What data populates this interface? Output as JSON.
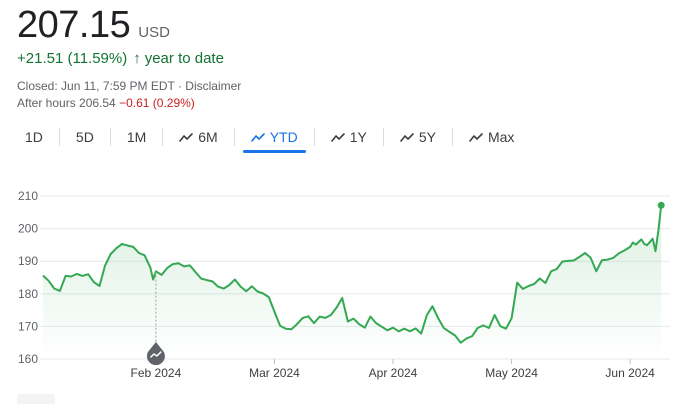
{
  "quote": {
    "price": "207.15",
    "currency": "USD",
    "change": "+21.51 (11.59%)",
    "arrow": "↑",
    "period": "year to date",
    "closed": "Closed: Jun 11, 7:59 PM EDT · Disclaimer",
    "after_hours_label": "After hours 206.54",
    "after_hours_change": "−0.61 (0.29%)"
  },
  "tabs": [
    {
      "label": "1D",
      "icon": false,
      "active": false
    },
    {
      "label": "5D",
      "icon": false,
      "active": false
    },
    {
      "label": "1M",
      "icon": false,
      "active": false
    },
    {
      "label": "6M",
      "icon": true,
      "active": false
    },
    {
      "label": "YTD",
      "icon": true,
      "active": true
    },
    {
      "label": "1Y",
      "icon": true,
      "active": false
    },
    {
      "label": "5Y",
      "icon": true,
      "active": false
    },
    {
      "label": "Max",
      "icon": true,
      "active": false
    }
  ],
  "colors": {
    "up": "#137333",
    "down": "#c5221f",
    "line": "#34a853",
    "accent": "#1a73e8"
  },
  "chart_data": {
    "type": "line",
    "ylim": [
      160,
      210
    ],
    "yticks": [
      160,
      170,
      180,
      190,
      200,
      210
    ],
    "xticks": [
      {
        "label": "Feb 2024",
        "x": 20
      },
      {
        "label": "Mar 2024",
        "x": 41
      },
      {
        "label": "Apr 2024",
        "x": 62
      },
      {
        "label": "May 2024",
        "x": 83
      },
      {
        "label": "Jun 2024",
        "x": 104
      }
    ],
    "x_range": [
      0,
      110
    ],
    "grid": true,
    "marker": {
      "x": 20,
      "y": 186.8,
      "icon": "trend-icon"
    },
    "end_point": {
      "x": 109.5,
      "y": 207.15
    },
    "series": [
      {
        "values": [
          [
            0,
            185.6
          ],
          [
            1,
            184
          ],
          [
            2,
            181.6
          ],
          [
            3,
            180.9
          ],
          [
            4,
            185.5
          ],
          [
            5,
            185.3
          ],
          [
            6,
            186.1
          ],
          [
            7,
            185.5
          ],
          [
            8,
            186
          ],
          [
            9,
            183.6
          ],
          [
            10,
            182.4
          ],
          [
            11,
            188.7
          ],
          [
            12,
            192.2
          ],
          [
            13,
            194
          ],
          [
            14,
            195.3
          ],
          [
            15,
            194.8
          ],
          [
            16,
            194.4
          ],
          [
            17,
            192.5
          ],
          [
            18,
            191.8
          ],
          [
            19,
            188.1
          ],
          [
            19.5,
            184.4
          ],
          [
            20,
            186.9
          ],
          [
            21,
            185.8
          ],
          [
            22,
            187.9
          ],
          [
            23,
            189.1
          ],
          [
            24,
            189.4
          ],
          [
            25,
            188.4
          ],
          [
            26,
            188.7
          ],
          [
            27,
            186.7
          ],
          [
            28,
            184.7
          ],
          [
            29,
            184.2
          ],
          [
            30,
            183.8
          ],
          [
            31,
            182.2
          ],
          [
            32,
            181.6
          ],
          [
            33,
            182.7
          ],
          [
            34,
            184.4
          ],
          [
            35,
            182.2
          ],
          [
            36,
            180.8
          ],
          [
            37,
            182.3
          ],
          [
            38,
            180.7
          ],
          [
            39,
            180.1
          ],
          [
            40,
            179
          ],
          [
            41,
            174.5
          ],
          [
            42,
            170.2
          ],
          [
            43,
            169.3
          ],
          [
            44,
            169.1
          ],
          [
            45,
            170.7
          ],
          [
            46,
            172.6
          ],
          [
            47,
            173.1
          ],
          [
            48,
            171
          ],
          [
            49,
            173
          ],
          [
            50,
            172.6
          ],
          [
            51,
            173.5
          ],
          [
            52,
            175.8
          ],
          [
            53,
            178.7
          ],
          [
            54,
            171.5
          ],
          [
            55,
            172.4
          ],
          [
            56,
            170.7
          ],
          [
            57,
            169.6
          ],
          [
            58,
            173
          ],
          [
            59,
            171
          ],
          [
            60,
            169.9
          ],
          [
            61,
            168.8
          ],
          [
            62,
            169.6
          ],
          [
            63,
            168.5
          ],
          [
            64,
            169.3
          ],
          [
            65,
            168.5
          ],
          [
            66,
            169.4
          ],
          [
            67,
            167.8
          ],
          [
            68,
            173.5
          ],
          [
            69,
            176.2
          ],
          [
            70,
            172.5
          ],
          [
            71,
            169.5
          ],
          [
            72,
            168.3
          ],
          [
            73,
            167.2
          ],
          [
            74,
            165
          ],
          [
            75,
            166.3
          ],
          [
            76,
            167
          ],
          [
            77,
            169.5
          ],
          [
            78,
            170.3
          ],
          [
            79,
            169.5
          ],
          [
            80,
            173.5
          ],
          [
            81,
            170.1
          ],
          [
            82,
            169.3
          ],
          [
            83,
            172.5
          ],
          [
            84,
            183.4
          ],
          [
            85,
            181.5
          ],
          [
            86,
            182.4
          ],
          [
            87,
            183
          ],
          [
            88,
            184.7
          ],
          [
            89,
            183.3
          ],
          [
            90,
            186.9
          ],
          [
            91,
            187.6
          ],
          [
            92,
            189.9
          ],
          [
            93,
            190.1
          ],
          [
            94,
            190.2
          ],
          [
            95,
            191.3
          ],
          [
            96,
            192.5
          ],
          [
            97,
            191.1
          ],
          [
            98,
            186.9
          ],
          [
            99,
            190.3
          ],
          [
            100,
            190.5
          ],
          [
            101,
            191
          ],
          [
            102,
            192.4
          ],
          [
            103,
            193.3
          ],
          [
            104,
            194.4
          ],
          [
            104.5,
            195.7
          ],
          [
            105,
            195.1
          ],
          [
            106,
            196.7
          ],
          [
            106.5,
            195.3
          ],
          [
            107,
            194.9
          ],
          [
            108,
            196.9
          ],
          [
            108.5,
            193.1
          ],
          [
            109,
            199.5
          ],
          [
            109.5,
            207.15
          ]
        ]
      }
    ]
  }
}
